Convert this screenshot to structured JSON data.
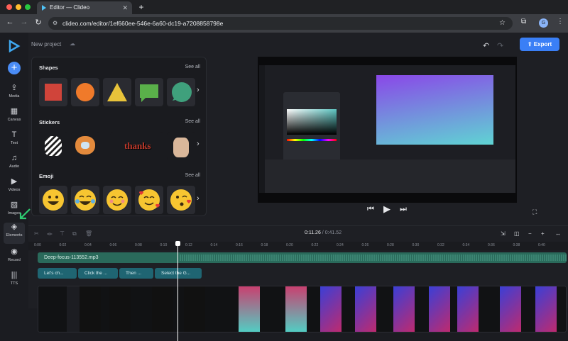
{
  "browser": {
    "tab_title": "Editor — Clideo",
    "url": "clideo.com/editor/1ef660ee-546e-6a60-dc19-a7208858798e",
    "avatar_letter": "G"
  },
  "app": {
    "project_title": "New project",
    "export_label": "Export",
    "sidebar": [
      {
        "label": "Media",
        "icon": "cloud-upload-icon"
      },
      {
        "label": "Canvas",
        "icon": "canvas-icon"
      },
      {
        "label": "Text",
        "icon": "text-icon"
      },
      {
        "label": "Audio",
        "icon": "music-icon"
      },
      {
        "label": "Videos",
        "icon": "play-icon"
      },
      {
        "label": "Images",
        "icon": "image-icon"
      },
      {
        "label": "Elements",
        "icon": "elements-icon"
      },
      {
        "label": "Record",
        "icon": "record-icon"
      },
      {
        "label": "TTS",
        "icon": "waveform-icon"
      }
    ],
    "sections": {
      "shapes": {
        "title": "Shapes",
        "see_all": "See all"
      },
      "stickers": {
        "title": "Stickers",
        "see_all": "See all"
      },
      "emoji": {
        "title": "Emoji",
        "see_all": "See all"
      }
    },
    "sticker_text": "thanks",
    "timeline": {
      "current": "0:11.26",
      "separator": "/",
      "duration": "0:41.52",
      "ticks": [
        "0:00",
        "0:02",
        "0:04",
        "0:06",
        "0:08",
        "0:10",
        "0:12",
        "0:14",
        "0:16",
        "0:18",
        "0:20",
        "0:22",
        "0:24",
        "0:26",
        "0:28",
        "0:30",
        "0:32",
        "0:34",
        "0:36",
        "0:38",
        "0:40"
      ],
      "audio_clip": "Deep-focus-113552.mp3",
      "subtitles": [
        "Let's ch...",
        "Click the ...",
        "Then ...",
        "Select the G..."
      ]
    }
  },
  "colors": {
    "accent": "#3a7ff6",
    "audio": "#2a6a5b",
    "subtitle": "#1f6572"
  }
}
